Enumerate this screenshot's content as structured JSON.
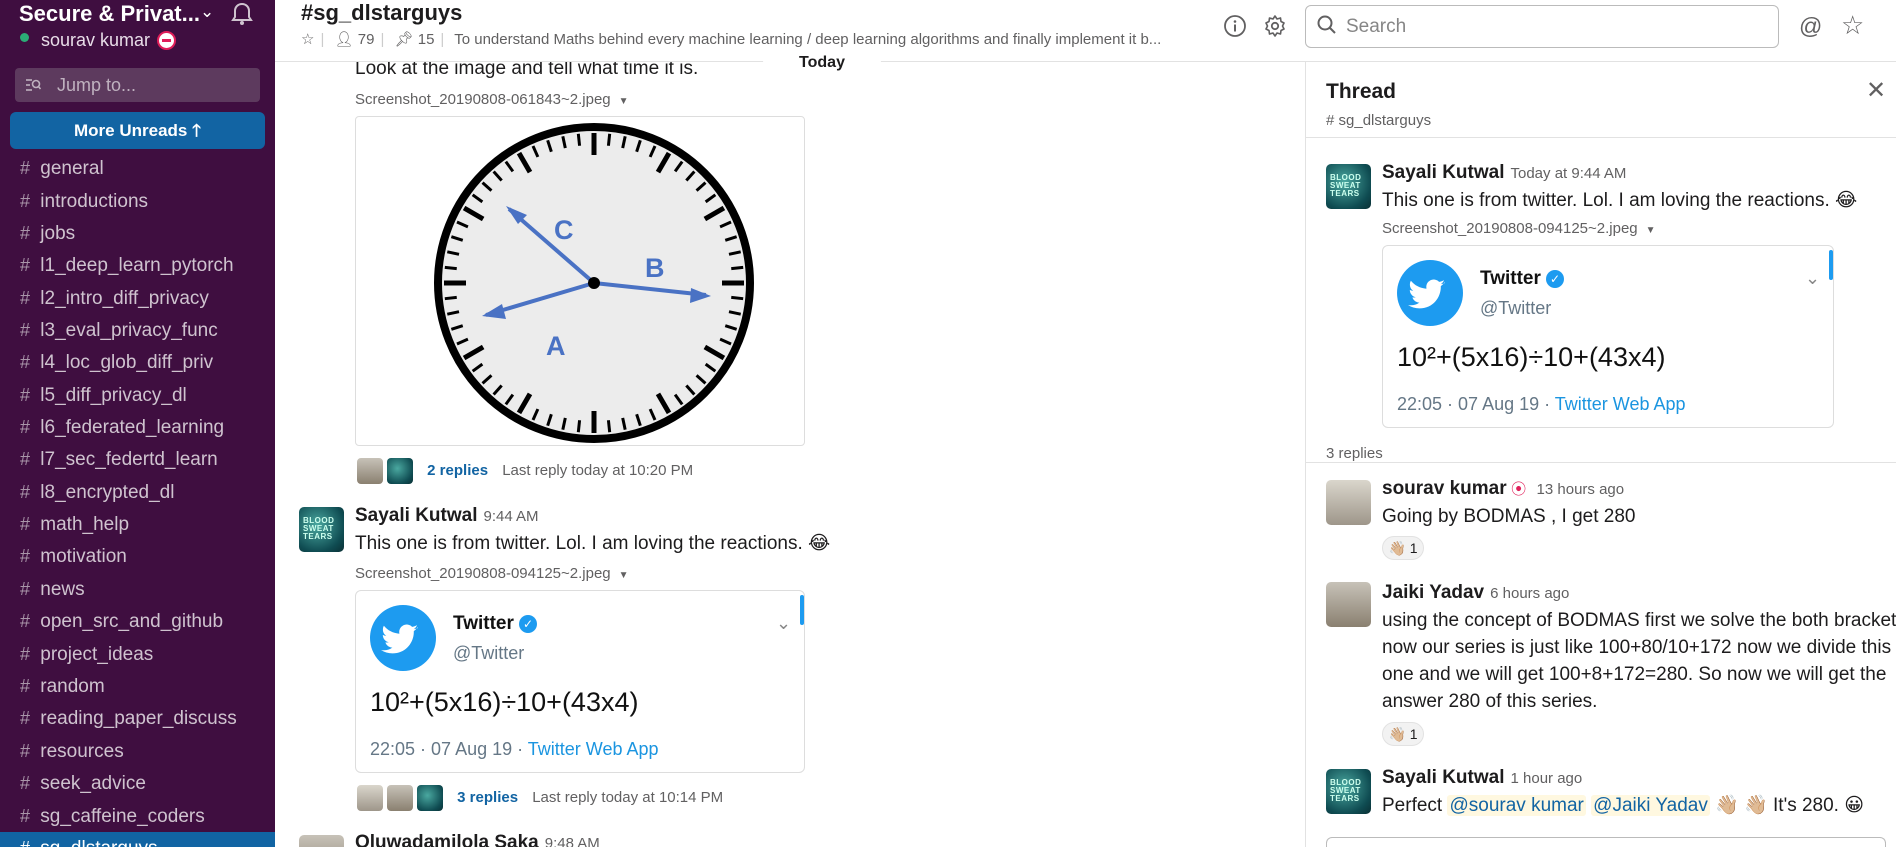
{
  "sidebar": {
    "workspace_name": "Secure & Privat...",
    "user_name": "sourav kumar",
    "jump_placeholder": "Jump to...",
    "more_unreads": "More Unreads",
    "channels": [
      {
        "name": "general"
      },
      {
        "name": "introductions"
      },
      {
        "name": "jobs"
      },
      {
        "name": "l1_deep_learn_pytorch"
      },
      {
        "name": "l2_intro_diff_privacy"
      },
      {
        "name": "l3_eval_privacy_func"
      },
      {
        "name": "l4_loc_glob_diff_priv"
      },
      {
        "name": "l5_diff_privacy_dl"
      },
      {
        "name": "l6_federated_learning"
      },
      {
        "name": "l7_sec_federtd_learn"
      },
      {
        "name": "l8_encrypted_dl"
      },
      {
        "name": "math_help"
      },
      {
        "name": "motivation"
      },
      {
        "name": "news"
      },
      {
        "name": "open_src_and_github"
      },
      {
        "name": "project_ideas"
      },
      {
        "name": "random"
      },
      {
        "name": "reading_paper_discuss"
      },
      {
        "name": "resources"
      },
      {
        "name": "seek_advice"
      },
      {
        "name": "sg_caffeine_coders"
      },
      {
        "name": "sg_dlstarguys"
      }
    ]
  },
  "header": {
    "channel_title": "#sg_dlstarguys",
    "members": "79",
    "pinned": "15",
    "topic": "To understand Maths behind every machine learning / deep learning algorithms and finally implement it b...",
    "search_placeholder": "Search"
  },
  "main": {
    "today_label": "Today",
    "messages": [
      {
        "text": "Look at the image and tell what time it is.",
        "file": "Screenshot_20190808-061843~2.jpeg",
        "clock_labels": [
          "A",
          "B",
          "C"
        ],
        "replies": "2 replies",
        "last_reply": "Last reply today at 10:20 PM"
      },
      {
        "sender": "Sayali Kutwal",
        "time": "9:44 AM",
        "text": "This one is from twitter. Lol. I am loving the reactions. 😂",
        "file": "Screenshot_20190808-094125~2.jpeg",
        "card": {
          "name": "Twitter",
          "handle": "@Twitter",
          "body": "10²+(5x16)÷10+(43x4)",
          "footer": "22:05 · 07 Aug 19 · ",
          "app": "Twitter Web App"
        },
        "replies": "3 replies",
        "last_reply": "Last reply today at 10:14 PM"
      },
      {
        "sender": "Oluwadamilola Saka",
        "time": "9:48 AM"
      }
    ]
  },
  "thread": {
    "title": "Thread",
    "channel": "sg_dlstarguys",
    "root": {
      "sender": "Sayali Kutwal",
      "time": "Today at 9:44 AM",
      "text": "This one is from twitter. Lol. I am loving the reactions. 😂",
      "file": "Screenshot_20190808-094125~2.jpeg",
      "card": {
        "name": "Twitter",
        "handle": "@Twitter",
        "body": "10²+(5x16)÷10+(43x4)",
        "footer": "22:05 · 07 Aug 19 · ",
        "app": "Twitter Web App"
      }
    },
    "replies_count": "3 replies",
    "replies": [
      {
        "sender": "sourav kumar",
        "time": "13 hours ago",
        "lines": [
          "Going by BODMAS , I get 280"
        ],
        "reaction": "👋🏼 1"
      },
      {
        "sender": "Jaiki Yadav",
        "time": "6 hours ago",
        "lines": [
          "using the concept of BODMAS first we solve the both bracket",
          "now our series is just like 100+80/10+172 now we divide this",
          "one and we will get 100+8+172=280. So now we will get the",
          "answer 280 of this  series."
        ],
        "reaction": "👋🏼 1"
      },
      {
        "sender": "Sayali Kutwal",
        "time": "1 hour ago",
        "pre": "Perfect ",
        "mention1": "@sourav kumar",
        "mention2": "@Jaiki Yadav",
        "post": " 👋🏼 👋🏼 It's 280. 😀"
      }
    ]
  },
  "colors": {
    "sidebar_bg": "#3f0e40",
    "active_blue": "#1164a3",
    "link_blue": "#1264a3",
    "twitter_blue": "#1d9bf0"
  }
}
